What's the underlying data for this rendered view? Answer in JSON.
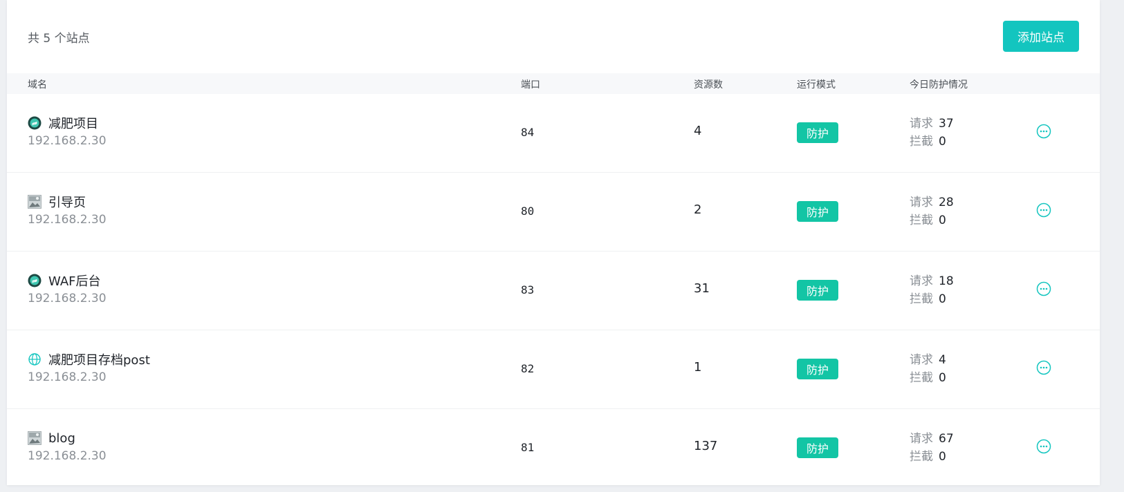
{
  "header": {
    "total_text": "共 5 个站点",
    "add_button_label": "添加站点"
  },
  "columns": {
    "domain": "域名",
    "port": "端口",
    "resources": "资源数",
    "mode": "运行模式",
    "protection": "今日防护情况"
  },
  "labels": {
    "requests": "请求",
    "blocked": "拦截"
  },
  "colors": {
    "accent": "#13c5bf",
    "badge": "#13c5a5",
    "icon_more": "#13c5bf"
  },
  "sites": [
    {
      "icon": "shield-logo-icon",
      "name": "减肥项目",
      "ip": "192.168.2.30",
      "port": "84",
      "resources": "4",
      "mode": "防护",
      "requests": "37",
      "blocked": "0"
    },
    {
      "icon": "image-thumbnail-icon",
      "name": "引导页",
      "ip": "192.168.2.30",
      "port": "80",
      "resources": "2",
      "mode": "防护",
      "requests": "28",
      "blocked": "0"
    },
    {
      "icon": "shield-logo-icon",
      "name": "WAF后台",
      "ip": "192.168.2.30",
      "port": "83",
      "resources": "31",
      "mode": "防护",
      "requests": "18",
      "blocked": "0"
    },
    {
      "icon": "globe-icon",
      "name": "减肥项目存档post",
      "ip": "192.168.2.30",
      "port": "82",
      "resources": "1",
      "mode": "防护",
      "requests": "4",
      "blocked": "0"
    },
    {
      "icon": "image-thumbnail-icon",
      "name": "blog",
      "ip": "192.168.2.30",
      "port": "81",
      "resources": "137",
      "mode": "防护",
      "requests": "67",
      "blocked": "0"
    }
  ]
}
